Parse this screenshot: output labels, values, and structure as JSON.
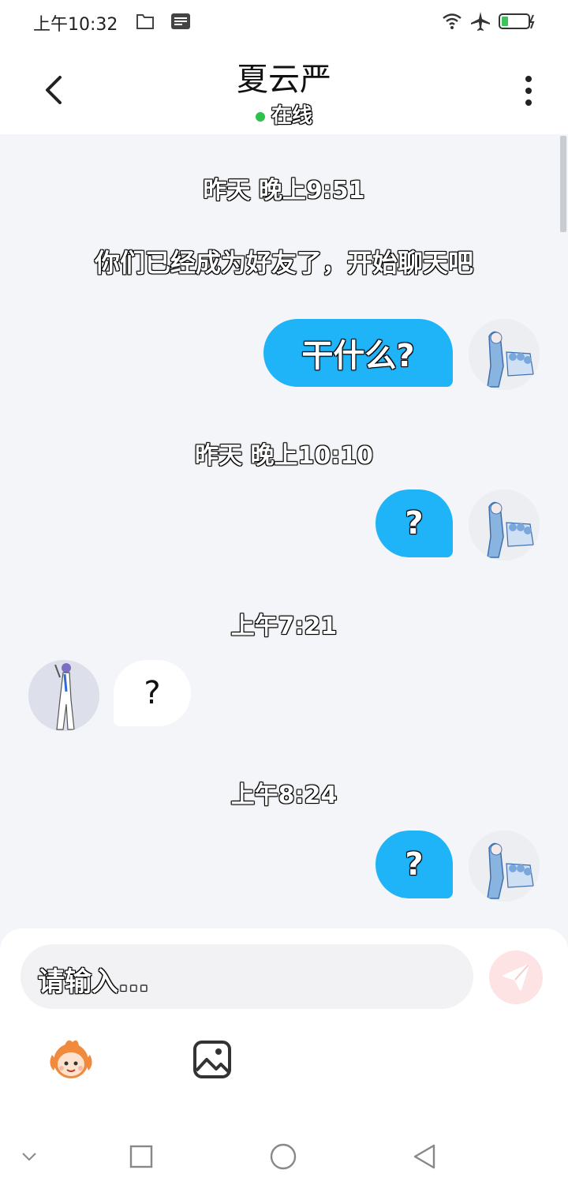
{
  "status_bar": {
    "time": "上午10:32"
  },
  "header": {
    "title": "夏云严",
    "status": "在线"
  },
  "messages": {
    "ts1": "昨天 晚上9:51",
    "system": "你们已经成为好友了，开始聊天吧",
    "m1": "干什么?",
    "ts2": "昨天 晚上10:10",
    "m2": "?",
    "ts3": "上午7:21",
    "m3": "?",
    "ts4": "上午8:24",
    "m4": "?"
  },
  "composer": {
    "placeholder": "请输入..."
  },
  "colors": {
    "out_bubble": "#1fb3f7",
    "online": "#2ec24d",
    "background": "#f3f5f8"
  }
}
